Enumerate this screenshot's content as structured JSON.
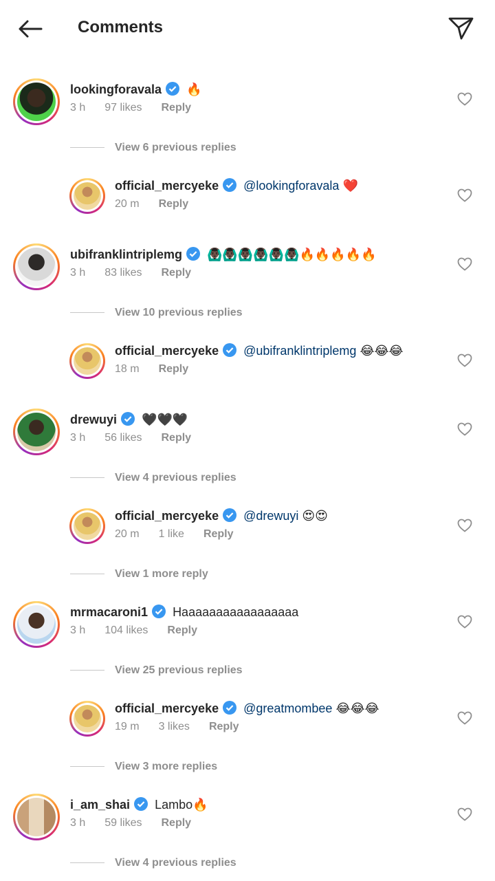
{
  "header": {
    "title": "Comments"
  },
  "icons": {
    "back": "arrow-left-icon",
    "send": "paper-plane-icon",
    "verified": "verified-badge-icon",
    "like": "heart-outline-icon"
  },
  "colors": {
    "gradient": [
      "#feda75",
      "#fa7e1e",
      "#d62976",
      "#962fbf"
    ],
    "verified": "#3897f0",
    "mention": "#00376b"
  },
  "comments": [
    {
      "username": "lookingforavala",
      "text": "🔥",
      "time": "3 h",
      "likes": "97 likes",
      "reply_label": "Reply"
    },
    {
      "username": "official_mercyeke",
      "mention": "@lookingforavala",
      "text": "❤️",
      "time": "20 m",
      "likes": "",
      "reply_label": "Reply"
    },
    {
      "username": "ubifranklintriplemg",
      "text": "🙆🏿‍♂️🙆🏿‍♂️🙆🏿‍♂️🙆🏿‍♂️🙆🏿‍♂️🙆🏿‍♂️🔥🔥🔥🔥🔥",
      "time": "3 h",
      "likes": "83 likes",
      "reply_label": "Reply"
    },
    {
      "username": "official_mercyeke",
      "mention": "@ubifranklintriplemg",
      "text": "😂😂😂",
      "time": "18 m",
      "likes": "",
      "reply_label": "Reply"
    },
    {
      "username": "drewuyi",
      "text": "🖤🖤🖤",
      "time": "3 h",
      "likes": "56 likes",
      "reply_label": "Reply"
    },
    {
      "username": "official_mercyeke",
      "mention": "@drewuyi",
      "text": "😍😍",
      "time": "20 m",
      "likes": "1 like",
      "reply_label": "Reply"
    },
    {
      "username": "mrmacaroni1",
      "text": "Haaaaaaaaaaaaaaaaa",
      "time": "3 h",
      "likes": "104 likes",
      "reply_label": "Reply"
    },
    {
      "username": "official_mercyeke",
      "mention": "@greatmombee",
      "text": "😂😂😂",
      "time": "19 m",
      "likes": "3 likes",
      "reply_label": "Reply"
    },
    {
      "username": "i_am_shai",
      "text": "Lambo🔥",
      "time": "3 h",
      "likes": "59 likes",
      "reply_label": "Reply"
    }
  ],
  "view_links": [
    "View 6 previous replies",
    "View 10 previous replies",
    "View 4 previous replies",
    "View 1 more reply",
    "View 25 previous replies",
    "View 3 more replies",
    "View 4 previous replies"
  ]
}
